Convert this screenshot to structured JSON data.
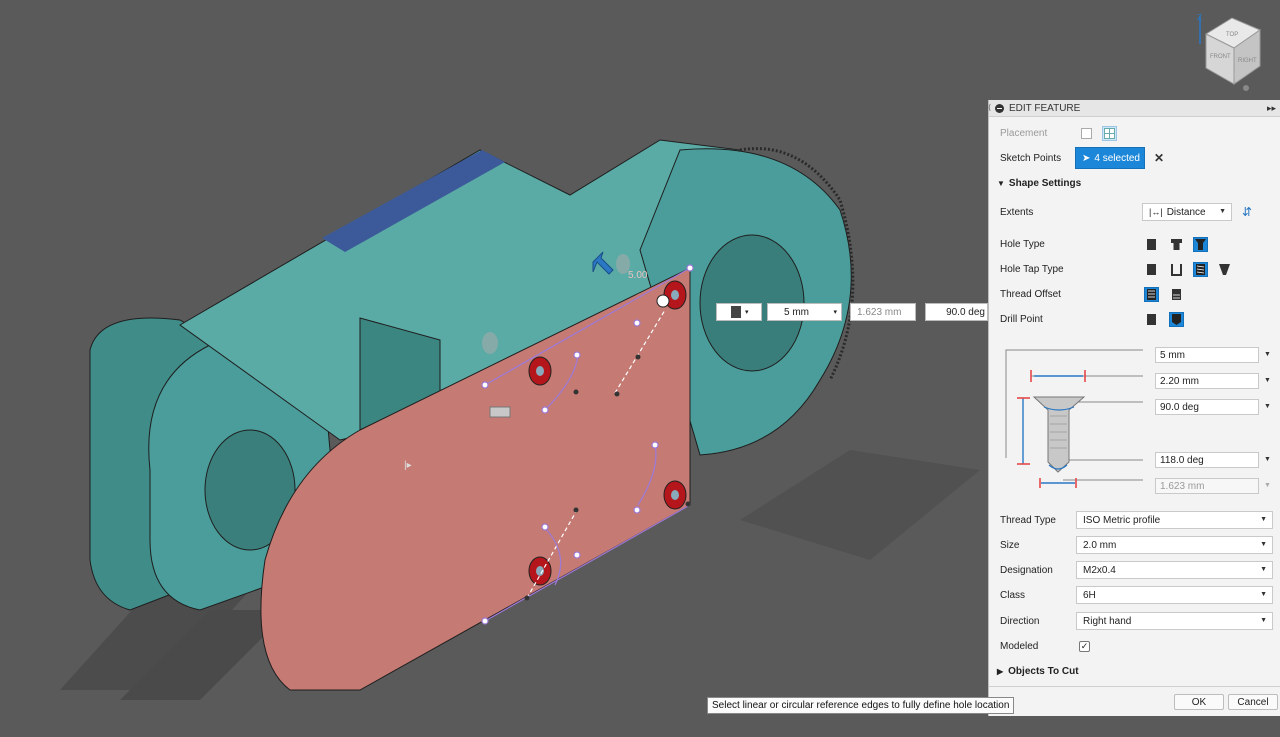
{
  "panel": {
    "title": "EDIT FEATURE",
    "placement_label": "Placement",
    "sketch_points_label": "Sketch Points",
    "sketch_points_value": "4 selected",
    "shape_settings_label": "Shape Settings",
    "extents_label": "Extents",
    "extents_value": "Distance",
    "hole_type_label": "Hole Type",
    "hole_tap_type_label": "Hole Tap Type",
    "thread_offset_label": "Thread Offset",
    "drill_point_label": "Drill Point",
    "diagram": {
      "depth": "5 mm",
      "diameter": "2.20 mm",
      "cs_angle": "90.0 deg",
      "drill_angle": "118.0 deg",
      "cs_diameter": "1.623 mm"
    },
    "thread_type_label": "Thread Type",
    "thread_type_value": "ISO Metric profile",
    "size_label": "Size",
    "size_value": "2.0 mm",
    "designation_label": "Designation",
    "designation_value": "M2x0.4",
    "class_label": "Class",
    "class_value": "6H",
    "direction_label": "Direction",
    "direction_value": "Right hand",
    "modeled_label": "Modeled",
    "objects_to_cut_label": "Objects To Cut",
    "ok_label": "OK",
    "cancel_label": "Cancel"
  },
  "viewport_hud": {
    "depth": "5 mm",
    "cs_dia": "1.623 mm",
    "angle": "90.0 deg",
    "ghost": "5.00"
  },
  "viewcube": {
    "axis": "Z",
    "top": "TOP",
    "front": "FRONT",
    "right": "RIGHT"
  },
  "tooltip": "Select linear or circular reference edges to fully define hole location",
  "colors": {
    "body": "#4a9d9a",
    "face": "#c97a74",
    "accent": "#1c87d8"
  }
}
